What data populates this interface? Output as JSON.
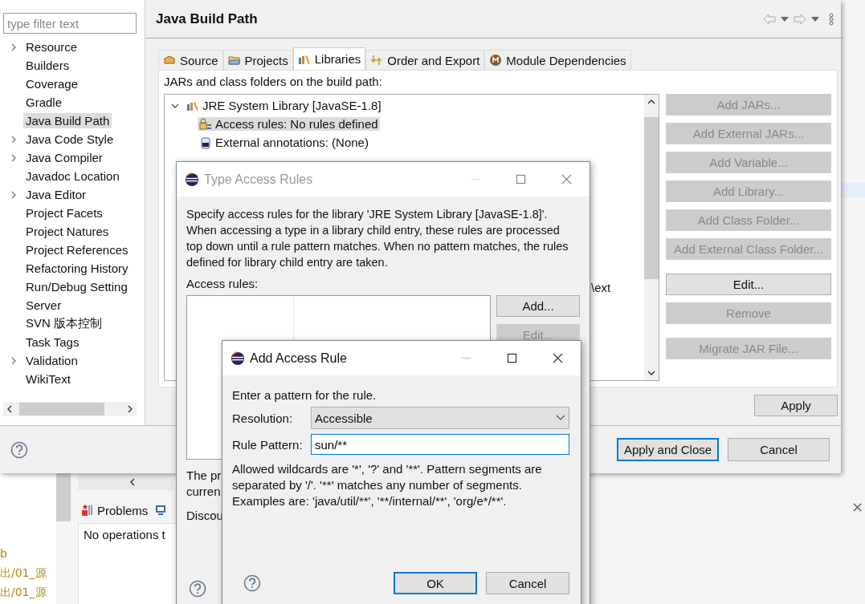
{
  "sidebar": {
    "filter": {
      "placeholder": "type filter text"
    },
    "items": [
      {
        "label": "Resource",
        "expandable": true,
        "selected": false
      },
      {
        "label": "Builders",
        "expandable": false,
        "selected": false
      },
      {
        "label": "Coverage",
        "expandable": false,
        "selected": false
      },
      {
        "label": "Gradle",
        "expandable": false,
        "selected": false
      },
      {
        "label": "Java Build Path",
        "expandable": false,
        "selected": true
      },
      {
        "label": "Java Code Style",
        "expandable": true,
        "selected": false
      },
      {
        "label": "Java Compiler",
        "expandable": true,
        "selected": false
      },
      {
        "label": "Javadoc Location",
        "expandable": false,
        "selected": false
      },
      {
        "label": "Java Editor",
        "expandable": true,
        "selected": false
      },
      {
        "label": "Project Facets",
        "expandable": false,
        "selected": false
      },
      {
        "label": "Project Natures",
        "expandable": false,
        "selected": false
      },
      {
        "label": "Project References",
        "expandable": false,
        "selected": false
      },
      {
        "label": "Refactoring History",
        "expandable": false,
        "selected": false
      },
      {
        "label": "Run/Debug Setting",
        "expandable": false,
        "selected": false
      },
      {
        "label": "Server",
        "expandable": false,
        "selected": false
      },
      {
        "label": "SVN 版本控制",
        "expandable": false,
        "selected": false
      },
      {
        "label": "Task Tags",
        "expandable": false,
        "selected": false
      },
      {
        "label": "Validation",
        "expandable": true,
        "selected": false
      },
      {
        "label": "WikiText",
        "expandable": false,
        "selected": false
      }
    ]
  },
  "page": {
    "title": "Java Build Path"
  },
  "tabs": [
    {
      "label": "Source",
      "kind": "source",
      "selected": false
    },
    {
      "label": "Projects",
      "kind": "projects",
      "selected": false
    },
    {
      "label": "Libraries",
      "kind": "libraries",
      "selected": true
    },
    {
      "label": "Order and Export",
      "kind": "order",
      "selected": false
    },
    {
      "label": "Module Dependencies",
      "kind": "module",
      "selected": false
    }
  ],
  "libraries": {
    "caption": "JARs and class folders on the build path:",
    "tree": [
      {
        "label": "JRE System Library [JavaSE-1.8]",
        "kind": "library",
        "expanded": true,
        "selected": false,
        "children": [
          {
            "label": "Access rules: No rules defined",
            "kind": "rules",
            "selected": true
          },
          {
            "label": "External annotations: (None)",
            "kind": "annotations",
            "selected": false
          }
        ]
      }
    ],
    "partial_row": "\\ext",
    "buttons": [
      {
        "label": "Add JARs...",
        "disabled": true
      },
      {
        "label": "Add External JARs...",
        "disabled": true
      },
      {
        "label": "Add Variable...",
        "disabled": true
      },
      {
        "label": "Add Library...",
        "disabled": true
      },
      {
        "label": "Add Class Folder...",
        "disabled": true
      },
      {
        "label": "Add External Class Folder...",
        "disabled": true
      },
      {
        "label": "Edit...",
        "disabled": false
      },
      {
        "label": "Remove",
        "disabled": true
      },
      {
        "label": "Migrate JAR File...",
        "disabled": true
      }
    ]
  },
  "apply_button": "Apply",
  "footer_buttons": [
    {
      "label": "Apply and Close",
      "default": true
    },
    {
      "label": "Cancel",
      "default": false
    }
  ],
  "type_access_rules": {
    "title": "Type Access Rules",
    "active": false,
    "description": "Specify access rules for the library 'JRE System Library [JavaSE-1.8]'. When accessing a type in a library child entry, these rules are processed top down until a rule pattern matches. When no pattern matches, the rules defined for library child entry are taken.",
    "list_label": "Access rules:",
    "buttons": [
      {
        "label": "Add...",
        "disabled": false
      },
      {
        "label": "Edit...",
        "disabled": true
      }
    ],
    "notes": [
      "The pr",
      "curren",
      "Discou"
    ]
  },
  "add_access_rule": {
    "title": "Add Access Rule",
    "active": true,
    "prompt": "Enter a pattern for the rule.",
    "resolution_label": "Resolution:",
    "resolution": "Accessible",
    "pattern_label": "Rule Pattern:",
    "pattern": "sun/**",
    "help": [
      "Allowed wildcards are '*', '?' and '**'. Pattern segments are separated by '/'. '**' matches any number of segments.",
      "Examples are: 'java/util/**', '**/internal/**', 'org/e*/**'."
    ],
    "buttons": [
      {
        "label": "OK",
        "default": true
      },
      {
        "label": "Cancel",
        "default": false
      }
    ]
  },
  "workbench": {
    "file_lines": [
      "b",
      "出/01_源",
      "出/01_源"
    ],
    "tabs": [
      {
        "label": "Problems"
      }
    ],
    "message": "No operations t"
  }
}
